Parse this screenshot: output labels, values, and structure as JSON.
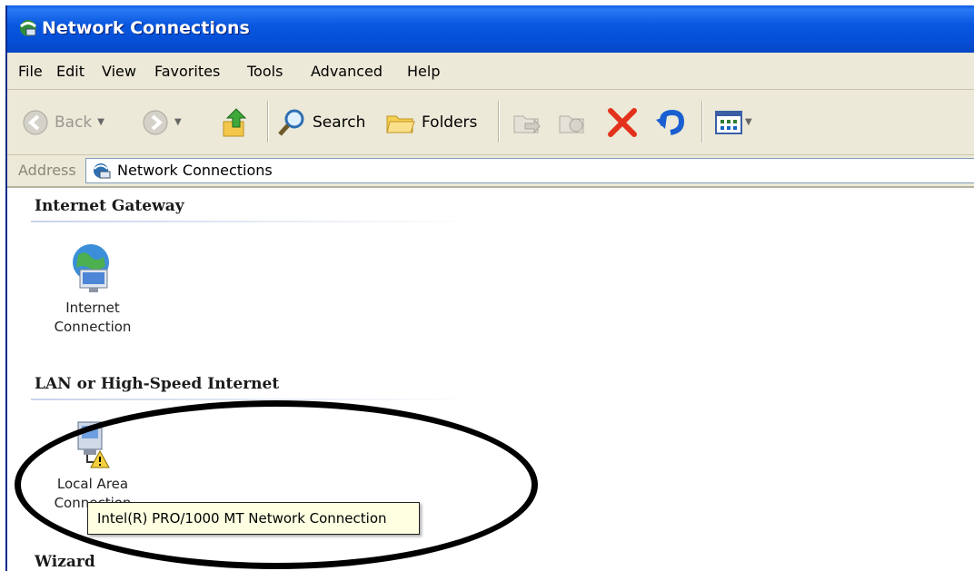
{
  "window": {
    "title": "Network Connections"
  },
  "menu": [
    "File",
    "Edit",
    "View",
    "Favorites",
    "Tools",
    "Advanced",
    "Help"
  ],
  "toolbar": {
    "back_label": "Back",
    "search_label": "Search",
    "folders_label": "Folders"
  },
  "address": {
    "label": "Address",
    "value": "Network Connections"
  },
  "groups": {
    "internet_gateway": {
      "heading": "Internet Gateway",
      "item_label_line1": "Internet",
      "item_label_line2": "Connection"
    },
    "lan": {
      "heading": "LAN or High-Speed Internet",
      "item_label_line1": "Local Area",
      "item_label_line2": "Connection"
    },
    "wizard": {
      "heading": "Wizard"
    }
  },
  "tooltip": {
    "text": "Intel(R) PRO/1000 MT Network Connection"
  },
  "colors": {
    "titlebar": "#0a58e0",
    "chrome": "#ece9d8",
    "tooltip": "#ffffe1",
    "annotation": "#000000"
  }
}
